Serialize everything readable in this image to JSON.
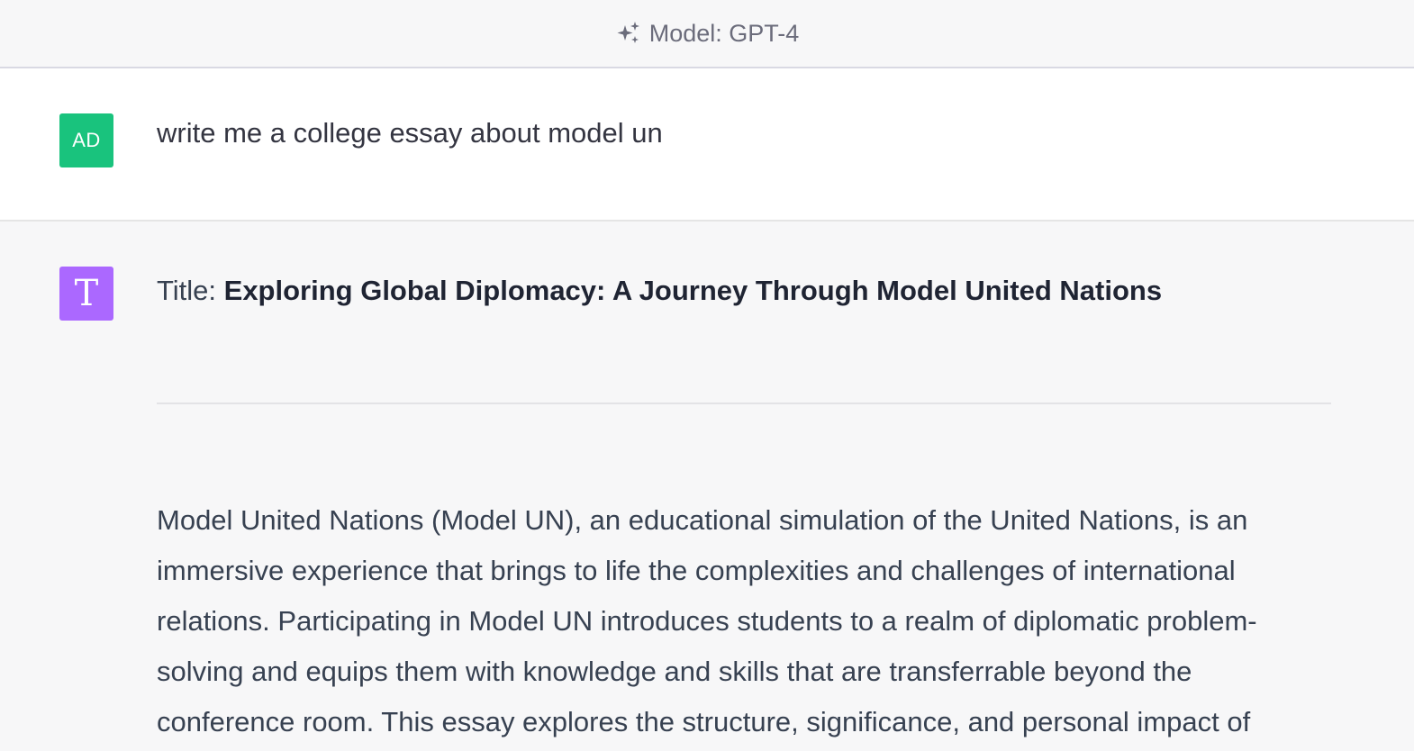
{
  "header": {
    "model_label": "Model: GPT-4",
    "icon": "sparkle-icon"
  },
  "user_message": {
    "avatar_initials": "AD",
    "avatar_color": "#19c37d",
    "text": "write me a college essay about model un"
  },
  "assistant_message": {
    "avatar_glyph": "T",
    "avatar_color": "#ab68ff",
    "title_prefix": "Title: ",
    "title": "Exploring Global Diplomacy: A Journey Through Model United Nations",
    "paragraph": "Model United Nations (Model UN), an educational simulation of the United Nations, is an immersive experience that brings to life the complexities and challenges of international relations. Participating in Model UN introduces students to a realm of diplomatic problem-solving and equips them with knowledge and skills that are transferrable beyond the conference room. This essay explores the structure, significance, and personal impact of"
  }
}
